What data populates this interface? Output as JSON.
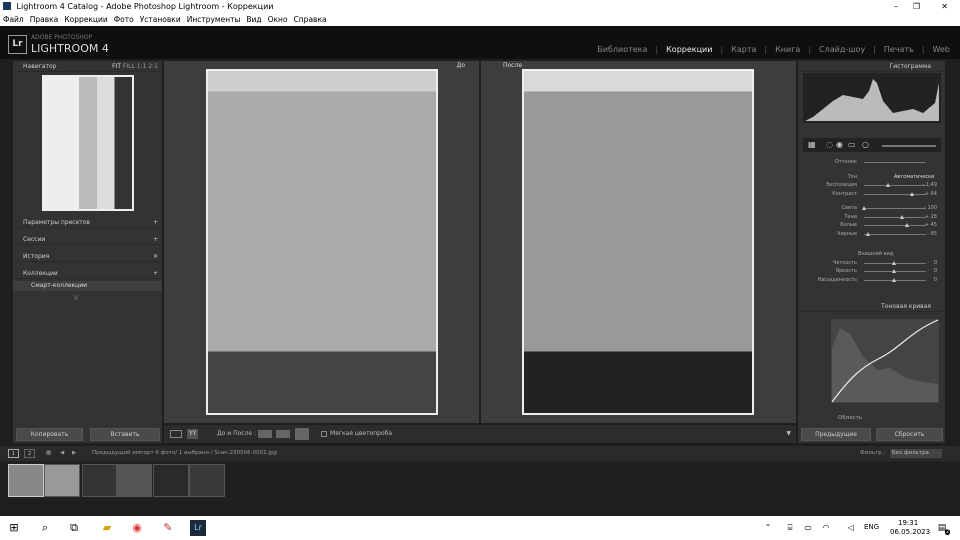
{
  "window": {
    "title": "Lightroom 4 Catalog - Adobe Photoshop Lightroom - Коррекции",
    "min": "–",
    "max": "❐",
    "close": "✕"
  },
  "menu": [
    "Файл",
    "Правка",
    "Коррекции",
    "Фото",
    "Установки",
    "Инструменты",
    "Вид",
    "Окно",
    "Справка"
  ],
  "brand": {
    "logo": "Lr",
    "line1": "ADOBE PHOTOSHOP",
    "line2": "LIGHTROOM 4"
  },
  "modules": [
    "Библиотека",
    "Коррекции",
    "Карта",
    "Книга",
    "Слайд-шоу",
    "Печать",
    "Web"
  ],
  "left": {
    "navigator": {
      "title": "Навигатор",
      "zoom": [
        "FIT",
        "FILL",
        "1:1",
        "2:1"
      ]
    },
    "sections": [
      {
        "label": "Параметры пресетов",
        "action": "+"
      },
      {
        "label": "Сессии",
        "action": "+"
      },
      {
        "label": "История",
        "action": "✕"
      },
      {
        "label": "Коллекции",
        "action": "+"
      }
    ],
    "collection_item": "Смарт-коллекции",
    "copy": "Копировать",
    "paste": "Вставить"
  },
  "center": {
    "before": "До",
    "after": "После",
    "toolbar": {
      "mode": "YY",
      "label": "До и После :",
      "softproof": "Мягкая цветопроба"
    }
  },
  "right": {
    "histogram": "Гистограмма",
    "original": "Оттенок",
    "tone": {
      "label": "Тон",
      "auto": "Автоматически",
      "rows": [
        {
          "name": "Экспозиция",
          "value": "- 1,49",
          "pos": 0.4
        },
        {
          "name": "Контраст",
          "value": "+ 64",
          "pos": 0.8
        },
        {
          "name": "Света",
          "value": "- 100",
          "pos": 0.0
        },
        {
          "name": "Тени",
          "value": "+ 28",
          "pos": 0.64
        },
        {
          "name": "Белые",
          "value": "+ 45",
          "pos": 0.72
        },
        {
          "name": "Черные",
          "value": "- 85",
          "pos": 0.07
        }
      ]
    },
    "presence": {
      "label": "Внешний вид",
      "rows": [
        {
          "name": "Четкость",
          "value": "0",
          "pos": 0.5
        },
        {
          "name": "Яркость",
          "value": "0",
          "pos": 0.5
        },
        {
          "name": "Насыщенность",
          "value": "0",
          "pos": 0.5
        }
      ]
    },
    "curve": "Тоновая кривая",
    "region": "Область",
    "previous": "Предыдущие",
    "reset": "Сбросить"
  },
  "filmstrip": {
    "info": "Предыдущий импорт  6 фото/ 1 выбрано / Scan-230506-0001.jpg",
    "filter_label": "Фильтр :",
    "filter_value": "Без фильтра",
    "page1": "1",
    "page2": "2"
  },
  "taskbar": {
    "lang": "ENG",
    "time": "19:31",
    "date": "06.05.2023",
    "notif": "2"
  }
}
